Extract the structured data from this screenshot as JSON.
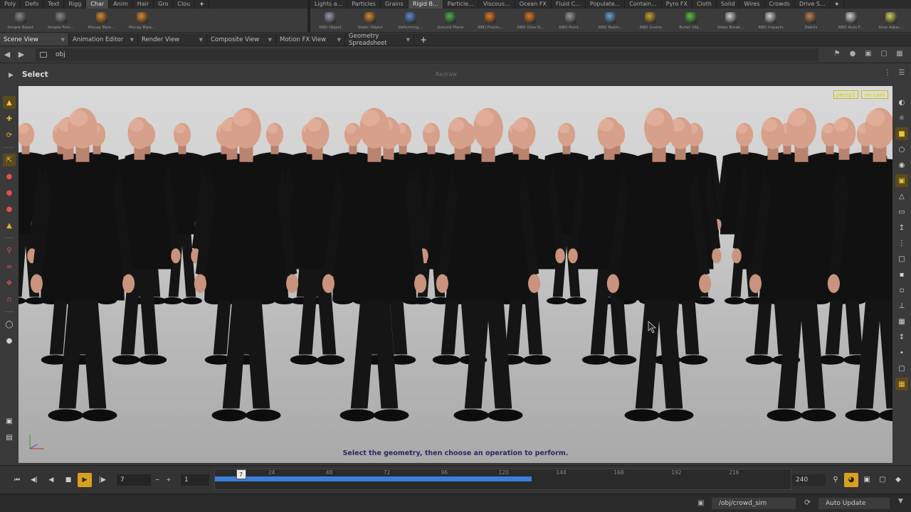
{
  "shelf_left": {
    "tabs": [
      "Poly",
      "Defo",
      "Text",
      "Rigg",
      "Char",
      "Anim",
      "Hair",
      "Gro",
      "Clou"
    ],
    "active_tab": "Char",
    "tools": [
      {
        "label": "Simple Biped",
        "icon": "biped-figure-icon",
        "color": "#8a8a8a"
      },
      {
        "label": "Simple Fem...",
        "icon": "female-figure-icon",
        "color": "#8a8a8a"
      },
      {
        "label": "Mocap Bipe...",
        "icon": "mocap-biped-icon",
        "color": "#d98a2e"
      },
      {
        "label": "Mocap Bipe...",
        "icon": "mocap-biped-icon",
        "color": "#d98a2e"
      }
    ]
  },
  "shelf_right": {
    "tabs": [
      "Lights a...",
      "Particles",
      "Grains",
      "Rigid B...",
      "Particle...",
      "Viscous...",
      "Ocean FX",
      "Fluid C...",
      "Populate...",
      "Contain...",
      "Pyro FX",
      "Cloth",
      "Solid",
      "Wires",
      "Crowds",
      "Drive S..."
    ],
    "active_tab": "Rigid B...",
    "tools": [
      {
        "label": "RBD Object",
        "icon": "rbd-object-icon",
        "color": "#9a9ab8"
      },
      {
        "label": "Static Object",
        "icon": "static-object-icon",
        "color": "#d9892e"
      },
      {
        "label": "Deforming...",
        "icon": "deforming-object-icon",
        "color": "#5a8ad0"
      },
      {
        "label": "Ground Plane",
        "icon": "ground-plane-icon",
        "color": "#4caf50"
      },
      {
        "label": "RBD Fractu...",
        "icon": "rbd-fracture-icon",
        "color": "#e07a20"
      },
      {
        "label": "RBD Glue O...",
        "icon": "rbd-glue-icon",
        "color": "#e07a20"
      },
      {
        "label": "RBD Point...",
        "icon": "rbd-point-icon",
        "color": "#999999"
      },
      {
        "label": "RBD Bakin...",
        "icon": "rbd-baking-icon",
        "color": "#6aa0d0"
      },
      {
        "label": "RBD Grains",
        "icon": "rbd-grains-icon",
        "color": "#d0a030"
      },
      {
        "label": "Bullet Obj...",
        "icon": "bullet-object-icon",
        "color": "#5cc040"
      },
      {
        "label": "Make Break...",
        "icon": "make-breakable-icon",
        "color": "#cfcfcf"
      },
      {
        "label": "RBD Impacts",
        "icon": "rbd-impacts-icon",
        "color": "#cfcfcf"
      },
      {
        "label": "Debris",
        "icon": "debris-icon",
        "color": "#c08050"
      },
      {
        "label": "RBD Auto F...",
        "icon": "rbd-auto-freeze-icon",
        "color": "#cfcfcf"
      },
      {
        "label": "Glue Adjac...",
        "icon": "glue-adjacent-icon",
        "color": "#d0d060"
      }
    ]
  },
  "pane_tabs": [
    "Scene View",
    "Animation Editor",
    "Render View",
    "Composite View",
    "Motion FX View",
    "Geometry Spreadsheet"
  ],
  "active_pane": "Scene View",
  "path": {
    "value": "obj"
  },
  "viewer": {
    "state_title": "Select",
    "render_label": "Redraw",
    "camera_chips": [
      "persp1",
      "no cam"
    ],
    "prompt": "Select the geometry, then choose an operation to perform."
  },
  "timeline": {
    "current_frame": "7",
    "step": "1",
    "start_field": "1",
    "end_frame": "240",
    "ticks": [
      "24",
      "48",
      "72",
      "96",
      "120",
      "144",
      "168",
      "192",
      "216"
    ],
    "cached_fraction": 0.55,
    "cursor_frame": 7
  },
  "status": {
    "node_path": "/obj/crowd_sim",
    "update_mode": "Auto Update"
  }
}
